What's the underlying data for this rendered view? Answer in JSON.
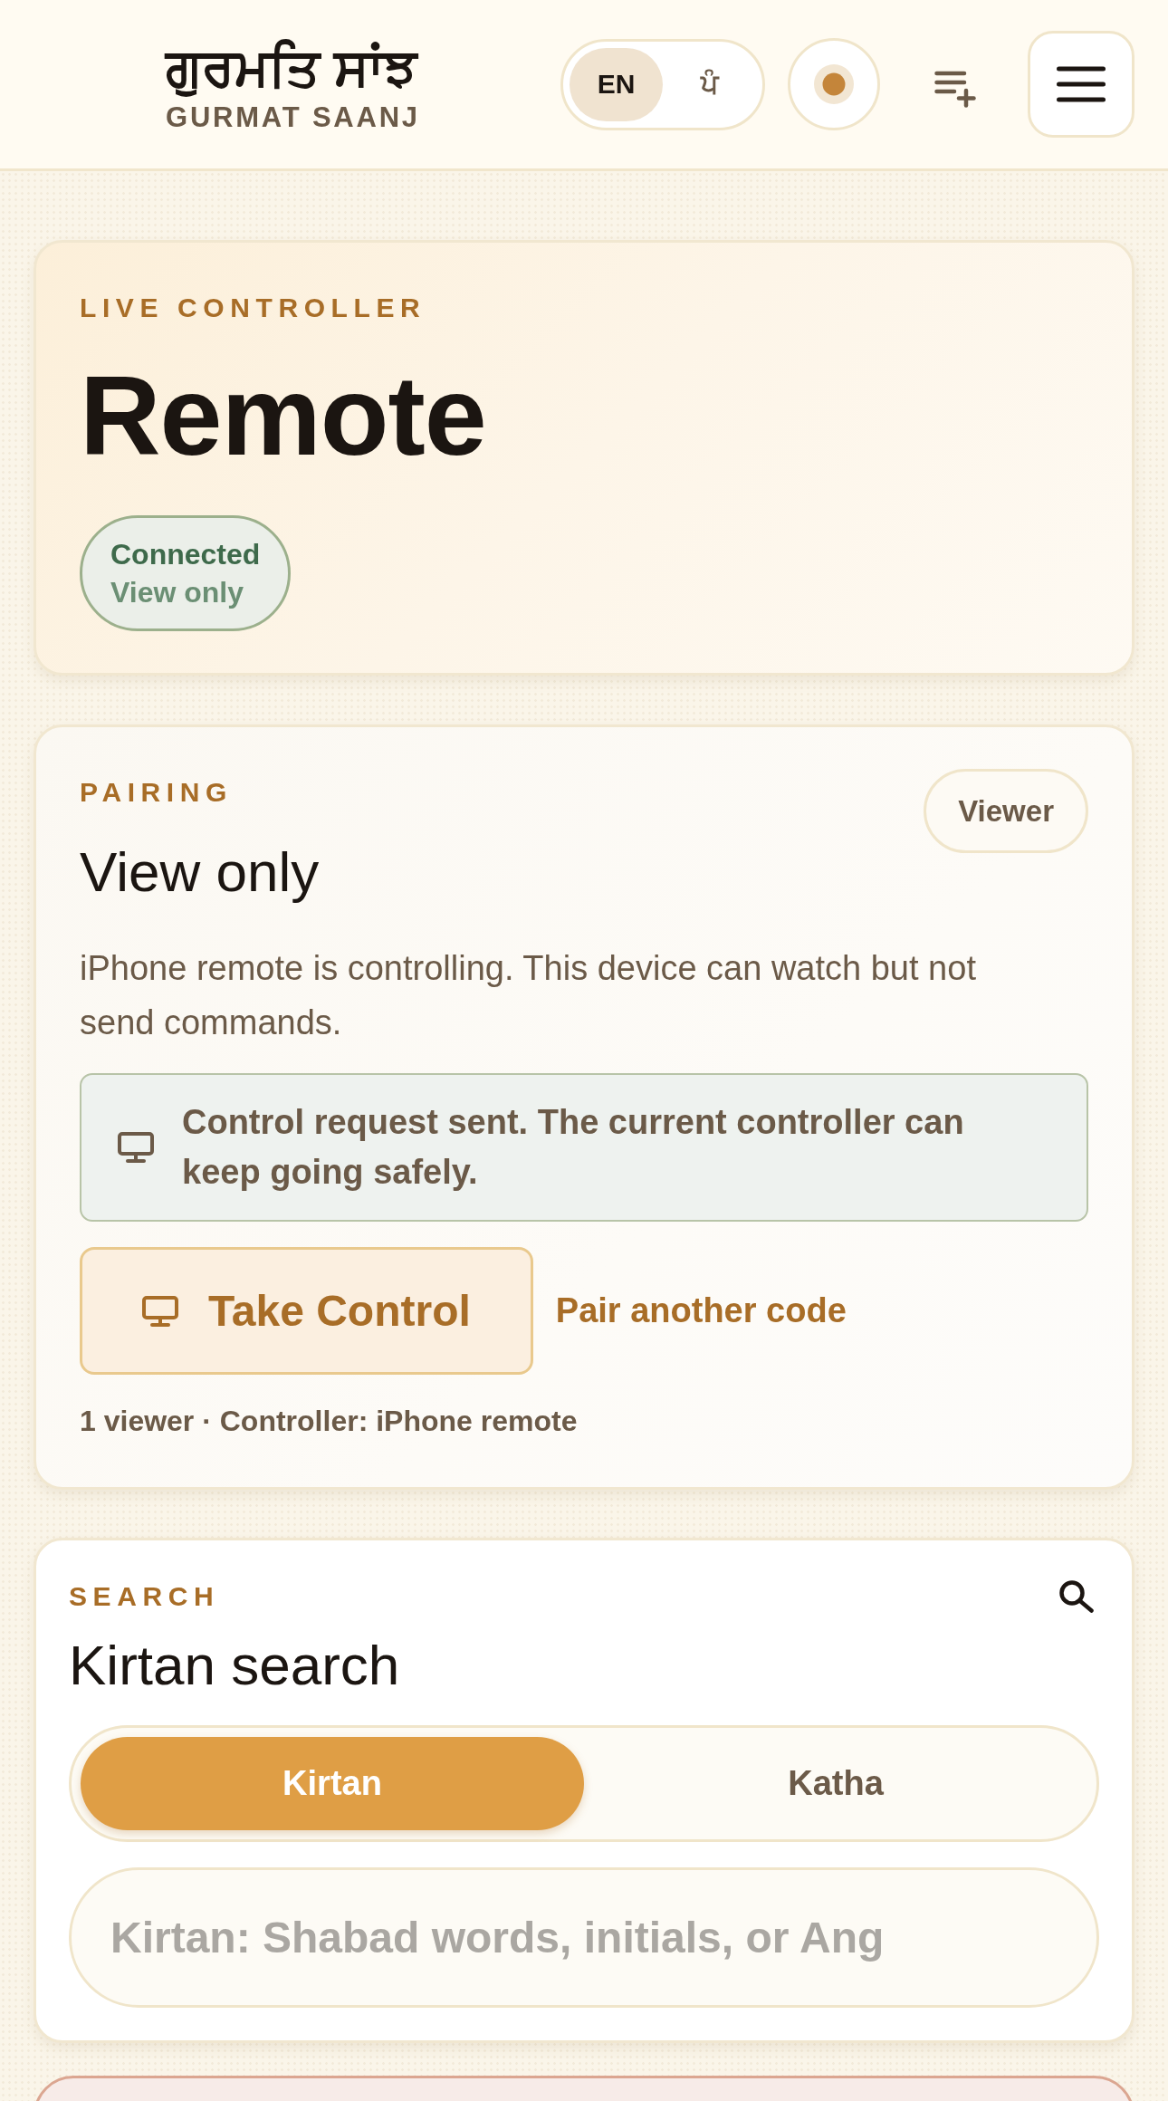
{
  "header": {
    "logo": {
      "title": "ਗੁਰਮਤਿ ਸਾਂਝ",
      "subtitle": "GURMAT SAANJ"
    },
    "languages": [
      {
        "label": "EN",
        "selected": true
      },
      {
        "label": "ਪੰ",
        "selected": false
      }
    ]
  },
  "hero": {
    "eyebrow": "LIVE CONTROLLER",
    "title": "Remote",
    "status": {
      "label": "Connected",
      "detail": "View only",
      "connected": true
    }
  },
  "pairing": {
    "eyebrow": "PAIRING",
    "title": "View only",
    "role": "Viewer",
    "description": "iPhone remote is controlling. This device can watch but not send commands.",
    "notice": "Control request sent. The current controller can keep going safely.",
    "primary_action": "Take Control",
    "secondary_action": "Pair another code",
    "footer": "1 viewer · Controller: iPhone remote"
  },
  "search": {
    "eyebrow": "SEARCH",
    "title": "Kirtan search",
    "modes": [
      {
        "label": "Kirtan",
        "selected": true
      },
      {
        "label": "Katha",
        "selected": false
      }
    ],
    "input": {
      "placeholder": "Kirtan: Shabad words, initials, or Ang"
    }
  }
}
